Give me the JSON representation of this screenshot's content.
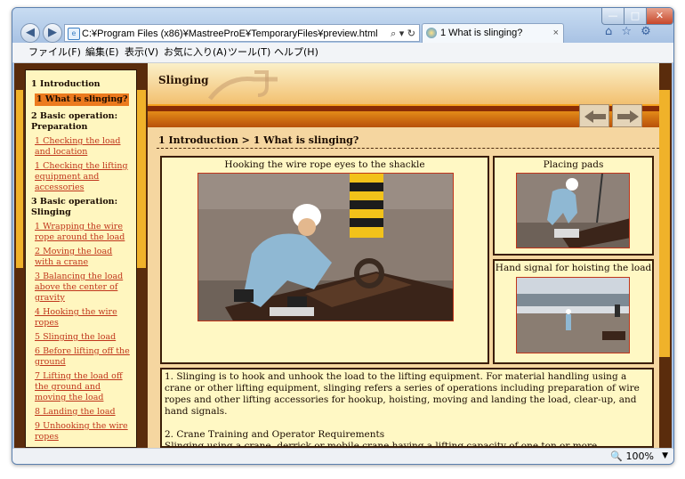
{
  "browser": {
    "address_url": "C:¥Program Files (x86)¥MastreeProE¥TemporaryFiles¥preview.html",
    "address_tools": "⌕ ▾ ↻",
    "tab_title": "1 What is slinging?",
    "tab_close": "×",
    "window_controls": {
      "minimize": "—",
      "maximize": "□",
      "close": "✕"
    },
    "menu": [
      "ファイル(F)",
      "編集(E)",
      "表示(V)",
      "お気に入り(A)",
      "ツール(T)",
      "ヘルプ(H)"
    ],
    "right_icons": "⌂ ☆ ⚙",
    "zoom": "🔍 100%",
    "zoom_dropdown": "▼"
  },
  "sidebar": {
    "sections": [
      {
        "title": "1 Introduction",
        "items": [
          {
            "label": "1 What is slinging?",
            "active": true
          }
        ]
      },
      {
        "title": "2 Basic operation: Preparation",
        "items": [
          {
            "label": "1 Checking the load and location"
          },
          {
            "label": "1 Checking the lifting equipment and accessories"
          }
        ]
      },
      {
        "title": "3 Basic operation: Slinging",
        "items": [
          {
            "label": "1 Wrapping the wire rope around the load"
          },
          {
            "label": "2 Moving the load with a crane"
          },
          {
            "label": "3 Balancing the load above the center of gravity"
          },
          {
            "label": "4 Hooking the wire ropes"
          },
          {
            "label": "5 Slinging the load"
          },
          {
            "label": "6 Before lifting off the ground"
          },
          {
            "label": "7 Lifting the load off the ground and moving the load"
          },
          {
            "label": "8 Landing the load"
          },
          {
            "label": "9 Unhooking the wire ropes"
          }
        ]
      }
    ]
  },
  "main": {
    "header_title": "Slinging",
    "breadcrumb": "1 Introduction > 1 What is slinging?",
    "panels": {
      "large": "Hooking the wire rope eyes to the shackle",
      "top_right": "Placing pads",
      "bottom_right": "Hand signal for hoisting the load"
    },
    "paragraphs": [
      "1. Slinging is to hook and unhook the load to the lifting equipment. For material handling using a crane or other lifting equipment, slinging refers a series of operations including preparation of wire ropes and other lifting accessories for hookup, hoisting, moving and landing the load, clear-up, and hand signals.",
      "2. Crane Training and Operator Requirements",
      "Slinging using a crane, derrick or mobile crane having a lifting capacity of one ton or more"
    ]
  },
  "colors": {
    "frame_brown": "#5a2c0c",
    "accent_orange": "#f7a51f",
    "link_red": "#c0361c",
    "panel_cream": "#fff8c4",
    "active_item": "#ec7a1e"
  }
}
